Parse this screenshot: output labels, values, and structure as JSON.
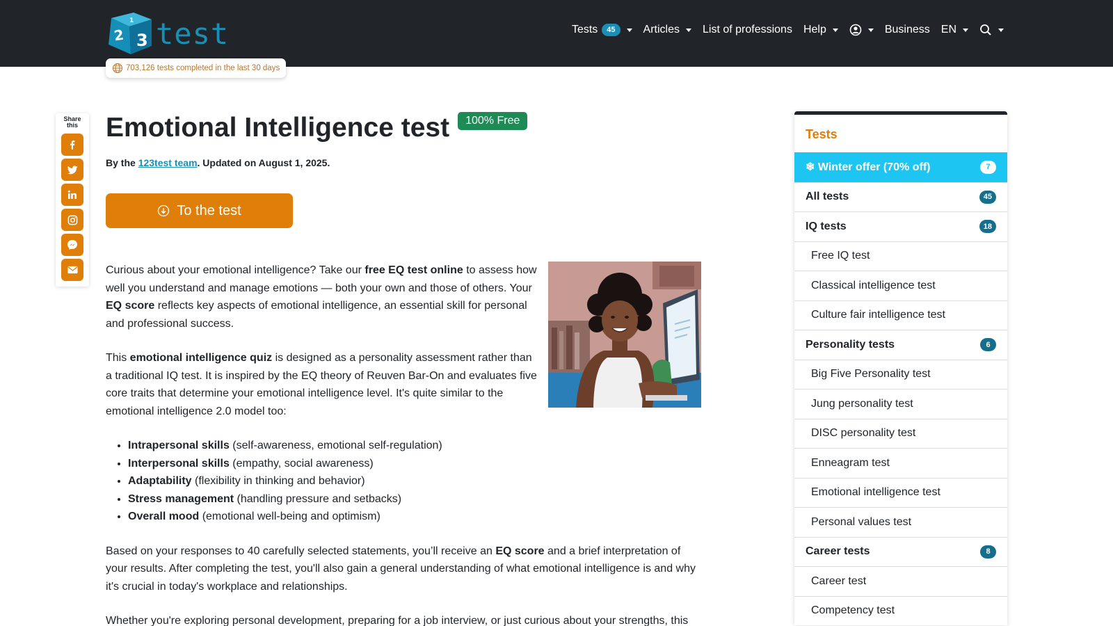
{
  "header": {
    "logo_text": "test",
    "stats": "703,126 tests completed in the last 30 days",
    "nav": {
      "tests_label": "Tests",
      "tests_count": "45",
      "articles_label": "Articles",
      "professions_label": "List of professions",
      "help_label": "Help",
      "business_label": "Business",
      "language_label": "EN"
    }
  },
  "share": {
    "label": "Share this",
    "icons": [
      "facebook-icon",
      "twitter-icon",
      "linkedin-icon",
      "instagram-icon",
      "messenger-icon",
      "email-icon"
    ]
  },
  "main": {
    "title": "Emotional Intelligence test",
    "badge": "100% Free",
    "byline_prefix": "By the ",
    "byline_link": "123test team",
    "byline_suffix": ". Updated on August 1, 2025.",
    "cta_label": "To the test",
    "p1": {
      "t1": "Curious about your emotional intelligence? Take our ",
      "b1": "free EQ test online",
      "t2": " to assess how well you understand and manage emotions — both your own and those of others. Your ",
      "b2": "EQ score",
      "t3": " reflects key aspects of emotional intelligence, an essential skill for personal and professional success."
    },
    "p2": {
      "t1": "This ",
      "b1": "emotional intelligence quiz",
      "t2": " is designed as a personality assessment rather than a traditional IQ test. It is inspired by the EQ theory of Reuven Bar-On and evaluates five core traits that determine your emotional intelligence level. It's quite similar to the emotional intelligence 2.0 model too:"
    },
    "traits": [
      {
        "name": "Intrapersonal skills",
        "desc": " (self-awareness, emotional self-regulation)"
      },
      {
        "name": "Interpersonal skills",
        "desc": " (empathy, social awareness)"
      },
      {
        "name": "Adaptability",
        "desc": " (flexibility in thinking and behavior)"
      },
      {
        "name": "Stress management",
        "desc": " (handling pressure and setbacks)"
      },
      {
        "name": "Overall mood",
        "desc": " (emotional well-being and optimism)"
      }
    ],
    "p3": {
      "t1": "Based on your responses to 40 carefully selected statements, you’ll receive an ",
      "b1": "EQ score",
      "t2": " and a brief interpretation of your results. After completing the test, you'll also gain a general understanding of what emotional intelligence is and why it's crucial in today's workplace and relationships."
    },
    "p4": "Whether you're exploring personal development, preparing for a job interview, or just curious about your strengths, this"
  },
  "sidebar": {
    "title": "Tests",
    "winter": {
      "label": "❄ Winter offer (70% off)",
      "count": "7"
    },
    "all": {
      "label": "All tests",
      "count": "45"
    },
    "iq": {
      "label": "IQ tests",
      "count": "18"
    },
    "iq_items": [
      "Free IQ test",
      "Classical intelligence test",
      "Culture fair intelligence test"
    ],
    "personality": {
      "label": "Personality tests",
      "count": "6"
    },
    "personality_items": [
      "Big Five Personality test",
      "Jung personality test",
      "DISC personality test",
      "Enneagram test",
      "Emotional intelligence test",
      "Personal values test"
    ],
    "career": {
      "label": "Career tests",
      "count": "8"
    },
    "career_items": [
      "Career test",
      "Competency test"
    ]
  },
  "colors": {
    "header_bg": "#212529",
    "accent_orange": "#e07e0a",
    "brand_blue": "#1a8fb5",
    "free_green": "#1e8a55",
    "winter_blue": "#1dc6f2"
  }
}
